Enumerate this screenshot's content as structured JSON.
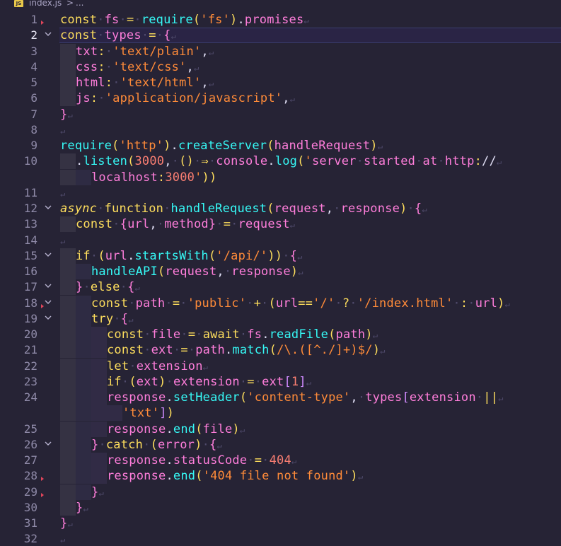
{
  "breadcrumb": {
    "file_icon": "JS",
    "file_name": "index.js",
    "separator": ">",
    "rest": "..."
  },
  "editor": {
    "line_numbers": [
      "1",
      "2",
      "3",
      "4",
      "5",
      "6",
      "7",
      "8",
      "9",
      "10",
      "",
      "11",
      "12",
      "13",
      "14",
      "15",
      "16",
      "17",
      "18",
      "19",
      "20",
      "21",
      "22",
      "23",
      "24",
      "",
      "25",
      "26",
      "27",
      "28",
      "29",
      "30",
      "31",
      "32"
    ],
    "lines": [
      "const fs = require('fs').promises",
      "const types = {",
      "txt: 'text/plain',",
      "css: 'text/css',",
      "html: 'text/html',",
      "js: 'application/javascript',",
      "}",
      "",
      "require('http').createServer(handleRequest)",
      ".listen(3000, () ⇒ console.log('server started at http://",
      "localhost:3000'))",
      "",
      "async function handleRequest(request, response) {",
      "const {url, method} = request",
      "",
      "if (url.startsWith('/api/')) {",
      "handleAPI(request, response)",
      "} else {",
      "const path = 'public' + (url=='/' ? '/index.html' : url)",
      "try {",
      "const file = await fs.readFile(path)",
      "const ext = path.match(/\\.([^./]+)$/)",
      "let extension",
      "if (ext) extension = ext[1]",
      "response.setHeader('content-type', types[extension ||",
      "'txt'])",
      "response.end(file)",
      "} catch (error) {",
      "response.statusCode = 404",
      "response.end('404 file not found')",
      "}",
      "}",
      "}",
      ""
    ]
  },
  "colors": {
    "background": "#262335",
    "keyword": "#fede5d",
    "string": "#ff8b39",
    "function": "#36f9f6",
    "variable": "#ff7edb",
    "number": "#f97e72"
  }
}
